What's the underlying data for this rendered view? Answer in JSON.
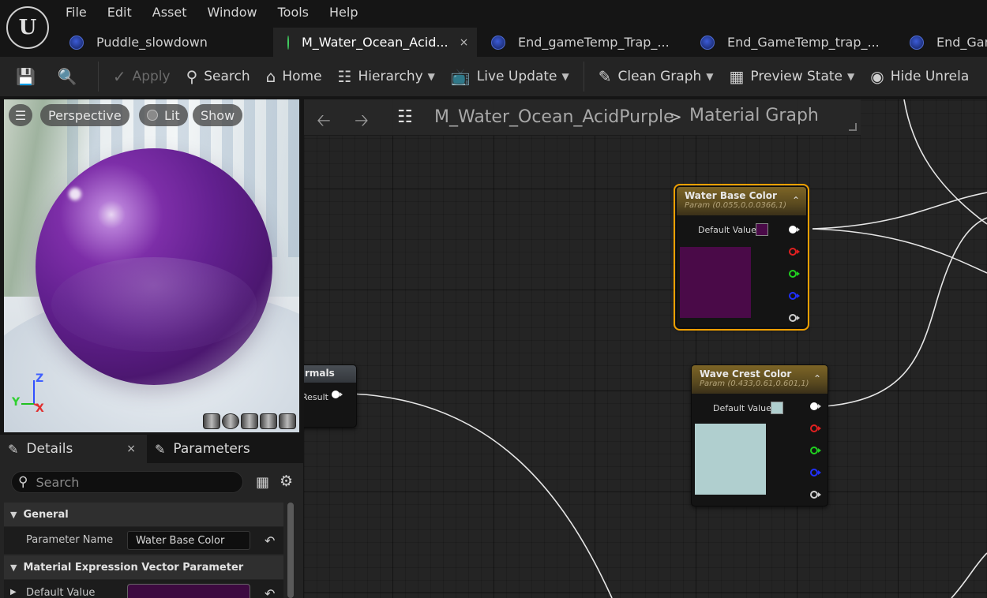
{
  "menu": [
    "File",
    "Edit",
    "Asset",
    "Window",
    "Tools",
    "Help"
  ],
  "logo_icon": "unreal-engine-logo",
  "tabs": [
    {
      "label": "Puddle_slowdown",
      "icon": "map-icon",
      "active": false
    },
    {
      "label": "M_Water_Ocean_Acid...",
      "icon": "material-icon",
      "active": true,
      "close": "×"
    },
    {
      "label": "End_gameTemp_Trap_...",
      "icon": "map-icon",
      "active": false
    },
    {
      "label": "End_GameTemp_trap_...",
      "icon": "map-icon",
      "active": false
    },
    {
      "label": "End_Gam",
      "icon": "map-icon",
      "active": false
    }
  ],
  "toolbar": {
    "apply": "Apply",
    "search": "Search",
    "home": "Home",
    "hierarchy": "Hierarchy",
    "live_update": "Live Update",
    "clean_graph": "Clean Graph",
    "preview_state": "Preview State",
    "hide_unrelated": "Hide Unrela"
  },
  "viewport": {
    "perspective": "Perspective",
    "lit": "Lit",
    "show": "Show",
    "axis_z": "Z",
    "axis_y": "Y",
    "axis_x": "X",
    "sphere_color": "#62208f"
  },
  "details": {
    "tab_details": "Details",
    "tab_close": "×",
    "tab_parameters": "Parameters",
    "search_placeholder": "Search",
    "cat_general": "General",
    "param_name_label": "Parameter Name",
    "param_name_value": "Water Base Color",
    "cat_vector": "Material Expression Vector Parameter",
    "default_value_label": "Default Value",
    "default_value_color": "#3d0a40"
  },
  "graph": {
    "breadcrumb_asset": "M_Water_Ocean_AcidPurple",
    "breadcrumb_sep": ">",
    "breadcrumb_graph": "Material Graph",
    "normals_title": "rmals",
    "normals_result": "Result",
    "water_base": {
      "title": "Water Base Color",
      "sub": "Param (0.055,0,0.0366,1)",
      "dv_label": "Default Value",
      "color": "#4a0a48"
    },
    "wave_crest": {
      "title": "Wave Crest Color",
      "sub": "Param (0.433,0.61,0.601,1)",
      "dv_label": "Default Value",
      "color": "#b0cfcf"
    }
  }
}
